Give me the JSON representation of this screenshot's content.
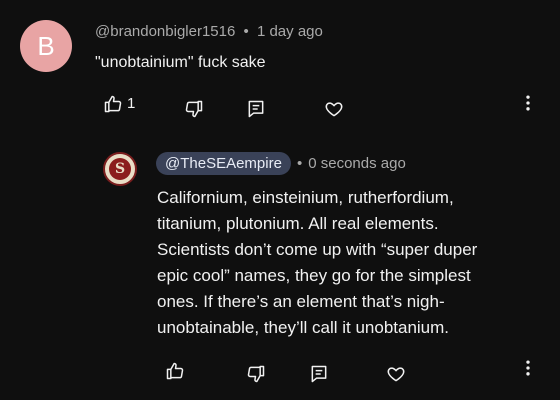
{
  "comment": {
    "avatar_letter": "B",
    "avatar_color": "#e8a4a4",
    "author": "@brandonbigler1516",
    "separator": "•",
    "time": "1 day ago",
    "text": "\"unobtainium\" fuck sake",
    "like_count": "1",
    "icons": [
      "thumbs-up-icon",
      "thumbs-down-icon",
      "reply-icon",
      "heart-icon",
      "more-vert-icon"
    ]
  },
  "reply": {
    "author": "@TheSEAempire",
    "separator": "•",
    "time": "0 seconds ago",
    "chip_color": "#3a4258",
    "seal_letter": "S",
    "lines": [
      "Californium, einsteinium, rutherfordium,",
      "titanium, plutonium. All real elements.",
      "Scientists don’t come up with “super duper",
      "epic cool” names, they go for the simplest",
      "ones. If there’s an element that’s nigh-",
      "unobtainable, they’ll call it unobtanium."
    ],
    "icons": [
      "thumbs-up-icon",
      "thumbs-down-icon",
      "reply-icon",
      "heart-icon",
      "more-vert-icon"
    ]
  }
}
